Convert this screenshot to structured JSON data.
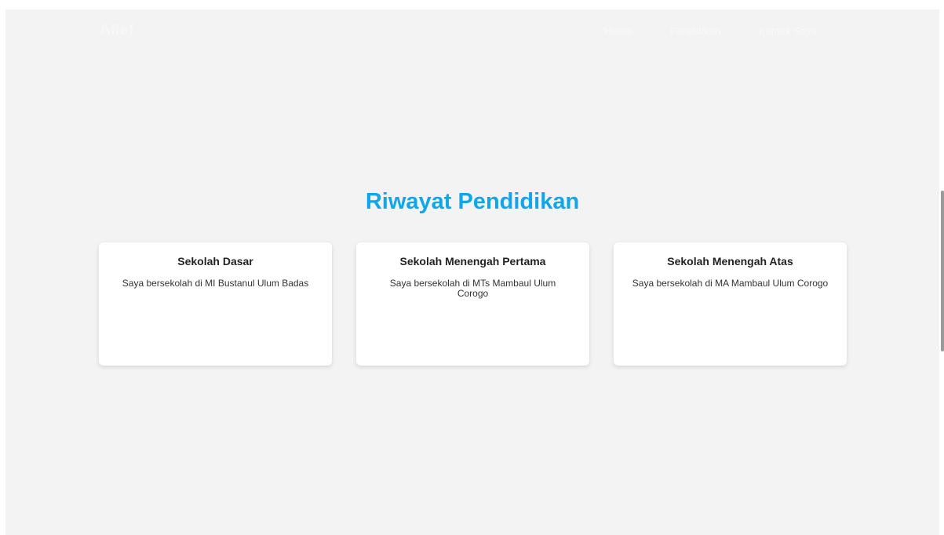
{
  "navbar": {
    "brand": "Alief",
    "links": [
      "Home",
      "Pendidikan",
      "Kontak Saya"
    ]
  },
  "section": {
    "title": "Riwayat Pendidikan",
    "cards": [
      {
        "title": "Sekolah Dasar",
        "text": "Saya bersekolah di MI Bustanul Ulum Badas"
      },
      {
        "title": "Sekolah Menengah Pertama",
        "text": "Saya bersekolah di MTs Mambaul Ulum Corogo"
      },
      {
        "title": "Sekolah Menengah Atas",
        "text": "Saya bersekolah di MA Mambaul Ulum Corogo"
      }
    ]
  },
  "colors": {
    "background": "#f3f3f3",
    "accent": "#0fa7e8",
    "card": "#ffffff"
  }
}
